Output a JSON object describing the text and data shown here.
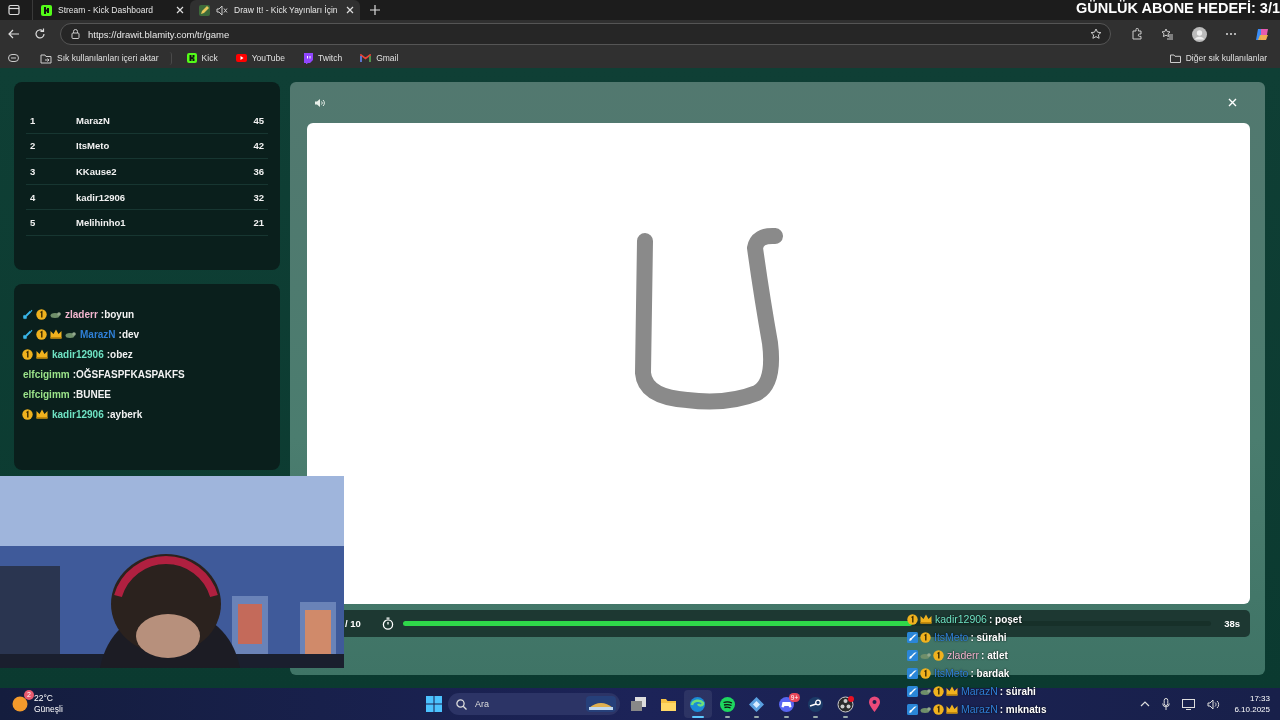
{
  "browser": {
    "tabs": [
      {
        "title": "Stream - Kick Dashboard",
        "kind": "logo",
        "selected": false,
        "muted": false
      },
      {
        "title": "Draw It! - Kick Yayınları İçin",
        "kind": "pencil",
        "selected": true,
        "muted": true
      }
    ],
    "url": "https://drawit.blamity.com/tr/game",
    "bookmarks": [
      {
        "label": "Sık kullanılanları içeri aktar",
        "kind": "import"
      },
      {
        "label": "Kick",
        "kind": "logo"
      },
      {
        "label": "YouTube",
        "kind": "play"
      },
      {
        "label": "Twitch",
        "kind": "bubble"
      },
      {
        "label": "Gmail",
        "kind": "mail"
      }
    ],
    "other_bookmarks": "Diğer sık kullanılanlar"
  },
  "stream_goal": "GÜNLÜK ABONE HEDEFİ: 3/1",
  "leaderboard": [
    {
      "rank": "1",
      "name": "MarazN",
      "score": "45"
    },
    {
      "rank": "2",
      "name": "ItsMeto",
      "score": "42"
    },
    {
      "rank": "3",
      "name": "KKause2",
      "score": "36"
    },
    {
      "rank": "4",
      "name": "kadir12906",
      "score": "32"
    },
    {
      "rank": "5",
      "name": "Melihinho1",
      "score": "21"
    }
  ],
  "game_chat": [
    {
      "badges": [
        {
          "kind": "mod"
        },
        {
          "kind": "sub"
        },
        {
          "kind": "emote"
        }
      ],
      "user": "zladerr",
      "color": "#f2b6cf",
      "text": ":boyun"
    },
    {
      "badges": [
        {
          "kind": "mod"
        },
        {
          "kind": "sub"
        },
        {
          "kind": "crown"
        },
        {
          "kind": "emote"
        }
      ],
      "user": "MarazN",
      "color": "#2f7fd6",
      "text": ":dev"
    },
    {
      "badges": [
        {
          "kind": "sub"
        },
        {
          "kind": "crown"
        }
      ],
      "user": "kadir12906",
      "color": "#6fe3c4",
      "text": ":obez"
    },
    {
      "user": "elfcigimm",
      "color": "#9be38a",
      "text": ":OĞSFASPFKASPAKFS"
    },
    {
      "user": "elfcigimm",
      "color": "#9be38a",
      "text": ":BUNEE"
    },
    {
      "badges": [
        {
          "kind": "sub"
        },
        {
          "kind": "crown"
        }
      ],
      "user": "kadir12906",
      "color": "#6fe3c4",
      "text": ":ayberk"
    }
  ],
  "round": {
    "label": "/ 10",
    "time_left": "38s",
    "level": 0.63
  },
  "stream_chat": [
    {
      "badges": [
        {
          "kind": "sub"
        },
        {
          "kind": "crown"
        }
      ],
      "user": "kadir12906",
      "color": "#6fe3c4",
      "text": ": poşet"
    },
    {
      "badges": [
        {
          "kind": "mod"
        },
        {
          "kind": "sub"
        }
      ],
      "user": "ItsMeto",
      "color": "#2f7fd6",
      "text": ": sürahi"
    },
    {
      "badges": [
        {
          "kind": "mod"
        },
        {
          "kind": "emote"
        },
        {
          "kind": "sub"
        }
      ],
      "user": "zladerr",
      "color": "#f2b6cf",
      "text": ": atlet"
    },
    {
      "badges": [
        {
          "kind": "mod"
        },
        {
          "kind": "sub"
        }
      ],
      "user": "ItsMeto",
      "color": "#2f7fd6",
      "text": ": bardak"
    },
    {
      "badges": [
        {
          "kind": "mod"
        },
        {
          "kind": "emote"
        },
        {
          "kind": "sub"
        },
        {
          "kind": "crown"
        }
      ],
      "user": "MarazN",
      "color": "#2f7fd6",
      "text": ": sürahi"
    },
    {
      "badges": [
        {
          "kind": "mod"
        },
        {
          "kind": "emote"
        },
        {
          "kind": "sub"
        },
        {
          "kind": "crown"
        }
      ],
      "user": "MarazN",
      "color": "#2f7fd6",
      "text": ": mıknatıs"
    }
  ],
  "taskbar": {
    "weather": {
      "temperature": "22°C",
      "condition": "Güneşli",
      "badge": "2"
    },
    "search": "Ara",
    "apps": [
      {
        "kind": "taskview",
        "running": false,
        "selected": false
      },
      {
        "kind": "folder",
        "running": false,
        "selected": false
      },
      {
        "kind": "browser",
        "running": true,
        "selected": true
      },
      {
        "kind": "music",
        "running": true,
        "selected": false
      },
      {
        "kind": "diamond",
        "running": true,
        "selected": false
      },
      {
        "kind": "controller",
        "running": true,
        "selected": false,
        "badge": "9+"
      },
      {
        "kind": "steam",
        "running": true,
        "selected": false
      },
      {
        "kind": "record",
        "running": true,
        "selected": false,
        "notification": true
      },
      {
        "kind": "pin",
        "running": false,
        "selected": false
      }
    ],
    "time": "17:33",
    "date": "6.10.2025"
  }
}
